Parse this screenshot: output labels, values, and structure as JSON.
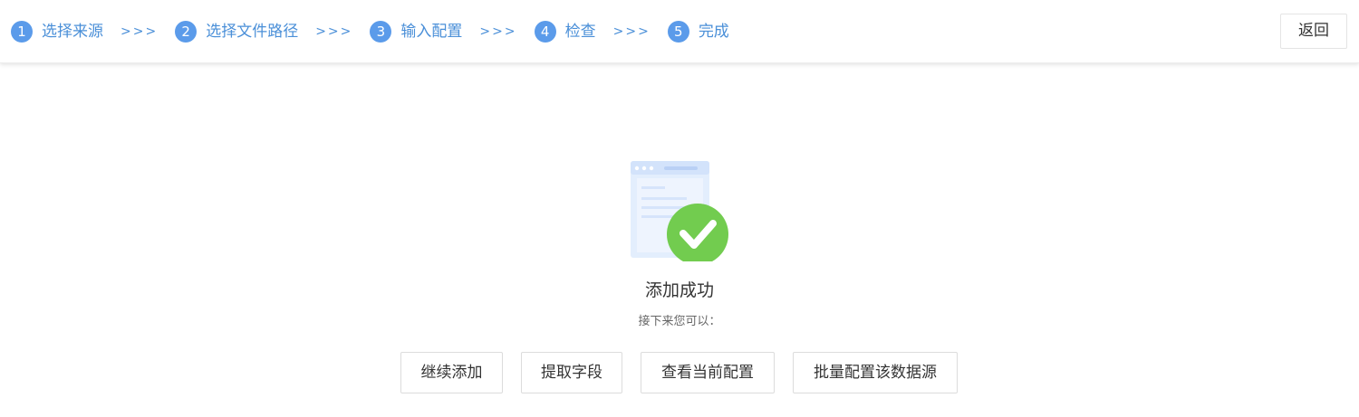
{
  "colors": {
    "step_accent": "#5b9bea",
    "step_text": "#4a8fd8",
    "success_green": "#72cc4f",
    "illustration_blue": "#d6e5fb"
  },
  "wizard": {
    "separator": ">>>",
    "steps": [
      {
        "number": "1",
        "label": "选择来源"
      },
      {
        "number": "2",
        "label": "选择文件路径"
      },
      {
        "number": "3",
        "label": "输入配置"
      },
      {
        "number": "4",
        "label": "检查"
      },
      {
        "number": "5",
        "label": "完成"
      }
    ]
  },
  "header": {
    "back_label": "返回"
  },
  "result": {
    "icon": "success-check-icon",
    "title": "添加成功",
    "subtitle": "接下来您可以："
  },
  "actions": [
    {
      "label": "继续添加"
    },
    {
      "label": "提取字段"
    },
    {
      "label": "查看当前配置"
    },
    {
      "label": "批量配置该数据源"
    }
  ]
}
